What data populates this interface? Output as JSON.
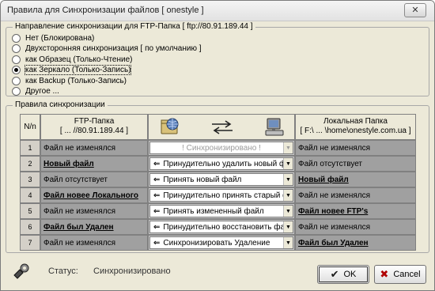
{
  "window": {
    "title": "Правила для Синхронизации файлов [ onestyle ]",
    "close": "✕"
  },
  "direction": {
    "legend": "Направление синхронизации для FTP-Папка [ ftp://80.91.189.44 ]",
    "options": [
      {
        "label": "Нет (Блокирована)",
        "checked": false
      },
      {
        "label": "Двухсторонняя синхронизация [ по умолчанию ]",
        "checked": false
      },
      {
        "label": "как Образец (Только-Чтение)",
        "checked": false
      },
      {
        "label": "как Зеркало (Только-Запись)",
        "checked": true
      },
      {
        "label": "как Backup (Только-Запись)",
        "checked": false
      },
      {
        "label": "Другое ...",
        "checked": false
      }
    ]
  },
  "rules": {
    "legend": "Правила синхронизации",
    "col_num": "N/n",
    "col_ftp_title": "FTP-Папка",
    "col_ftp_path": "[ ... //80.91.189.44 ]",
    "col_local_title": "Локальная Папка",
    "col_local_path": "[ F:\\ ... \\home\\onestyle.com.ua ]",
    "icons": {
      "left": "globe-folder-icon",
      "middle": "sync-arrows-icon",
      "right": "computer-icon"
    },
    "rows": [
      {
        "n": "1",
        "ftp": "Файл не изменялся",
        "ftp_bold": false,
        "action": "! Синхронизировано !",
        "action_disabled": true,
        "arrow": "",
        "local": "Файл не изменялся",
        "local_bold": false
      },
      {
        "n": "2",
        "ftp": "Новый файл",
        "ftp_bold": true,
        "action": "Принудительно удалить новый файл",
        "action_disabled": false,
        "arrow": "⇐",
        "local": "Файл отсутствует",
        "local_bold": false
      },
      {
        "n": "3",
        "ftp": "Файл отсутствует",
        "ftp_bold": false,
        "action": "Принять новый файл",
        "action_disabled": false,
        "arrow": "⇐",
        "local": "Новый файл",
        "local_bold": true
      },
      {
        "n": "4",
        "ftp": "Файл новее Локального",
        "ftp_bold": true,
        "action": "Принудительно принять старый файл",
        "action_disabled": false,
        "arrow": "⇐",
        "local": "Файл не изменялся",
        "local_bold": false
      },
      {
        "n": "5",
        "ftp": "Файл не изменялся",
        "ftp_bold": false,
        "action": "Принять измененный файл",
        "action_disabled": false,
        "arrow": "⇐",
        "local": "Файл новее FTP's",
        "local_bold": true
      },
      {
        "n": "6",
        "ftp": "Файл был Удален",
        "ftp_bold": true,
        "action": "Принудительно восстановить файл",
        "action_disabled": false,
        "arrow": "⇐",
        "local": "Файл не изменялся",
        "local_bold": false
      },
      {
        "n": "7",
        "ftp": "Файл не изменялся",
        "ftp_bold": false,
        "action": "Синхронизировать Удаление",
        "action_disabled": false,
        "arrow": "⇐",
        "local": "Файл был Удален",
        "local_bold": true
      }
    ]
  },
  "status": {
    "label": "Статус:",
    "value": "Синхронизировано",
    "icon": "tool-icon"
  },
  "buttons": {
    "ok": "OK",
    "cancel": "Cancel"
  },
  "colors": {
    "window_bg": "#ece9d8",
    "cell_bg": "#a0a0a0"
  }
}
